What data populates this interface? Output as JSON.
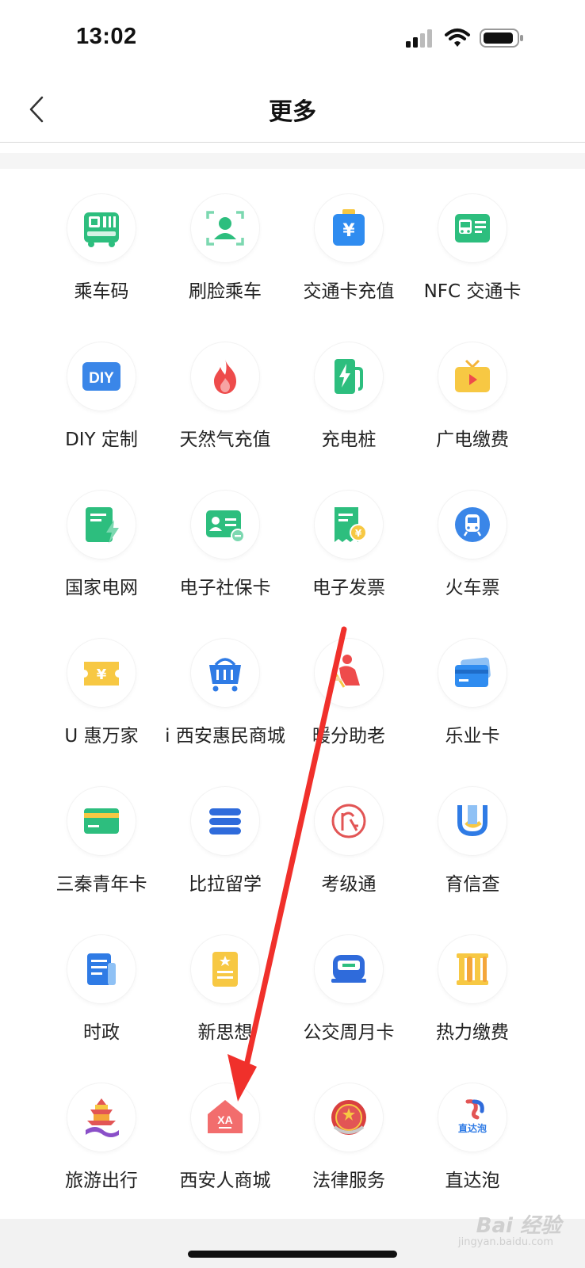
{
  "status_bar": {
    "time": "13:02"
  },
  "nav": {
    "title": "更多"
  },
  "grid_items": [
    {
      "label": "乘车码",
      "icon": "bus-code-icon"
    },
    {
      "label": "刷脸乘车",
      "icon": "face-scan-icon"
    },
    {
      "label": "交通卡充值",
      "icon": "card-recharge-icon"
    },
    {
      "label": "NFC 交通卡",
      "icon": "nfc-bus-card-icon"
    },
    {
      "label": "DIY 定制",
      "icon": "diy-icon"
    },
    {
      "label": "天然气充值",
      "icon": "flame-icon"
    },
    {
      "label": "充电桩",
      "icon": "charging-pile-icon"
    },
    {
      "label": "广电缴费",
      "icon": "tv-icon"
    },
    {
      "label": "国家电网",
      "icon": "power-grid-icon"
    },
    {
      "label": "电子社保卡",
      "icon": "social-security-card-icon"
    },
    {
      "label": "电子发票",
      "icon": "invoice-icon"
    },
    {
      "label": "火车票",
      "icon": "train-icon"
    },
    {
      "label": "U 惠万家",
      "icon": "coupon-icon"
    },
    {
      "label": "i 西安惠民商城",
      "icon": "shopping-basket-icon"
    },
    {
      "label": "暖分助老",
      "icon": "elderly-icon"
    },
    {
      "label": "乐业卡",
      "icon": "bank-card-icon"
    },
    {
      "label": "三秦青年卡",
      "icon": "youth-card-icon"
    },
    {
      "label": "比拉留学",
      "icon": "stack-icon"
    },
    {
      "label": "考级通",
      "icon": "exam-logo-icon"
    },
    {
      "label": "育信查",
      "icon": "education-check-icon"
    },
    {
      "label": "时政",
      "icon": "news-icon"
    },
    {
      "label": "新思想",
      "icon": "ideology-book-icon"
    },
    {
      "label": "公交周月卡",
      "icon": "bus-pass-icon"
    },
    {
      "label": "热力缴费",
      "icon": "radiator-icon"
    },
    {
      "label": "旅游出行",
      "icon": "travel-pagoda-icon"
    },
    {
      "label": "西安人商城",
      "icon": "xa-mall-icon"
    },
    {
      "label": "法律服务",
      "icon": "law-emblem-icon"
    },
    {
      "label": "直达泡",
      "icon": "zhidapao-logo-icon"
    }
  ],
  "zhidapao_logo_text": "直达泡",
  "xa_logo_text": "XA",
  "watermark": {
    "brand": "Bai 经验",
    "url": "jingyan.baidu.com"
  },
  "colors": {
    "green": "#2DBE7E",
    "blue": "#2F7BE5",
    "yellow": "#F7C843",
    "red": "#EE4B4B",
    "arrow": "#F0302B"
  }
}
